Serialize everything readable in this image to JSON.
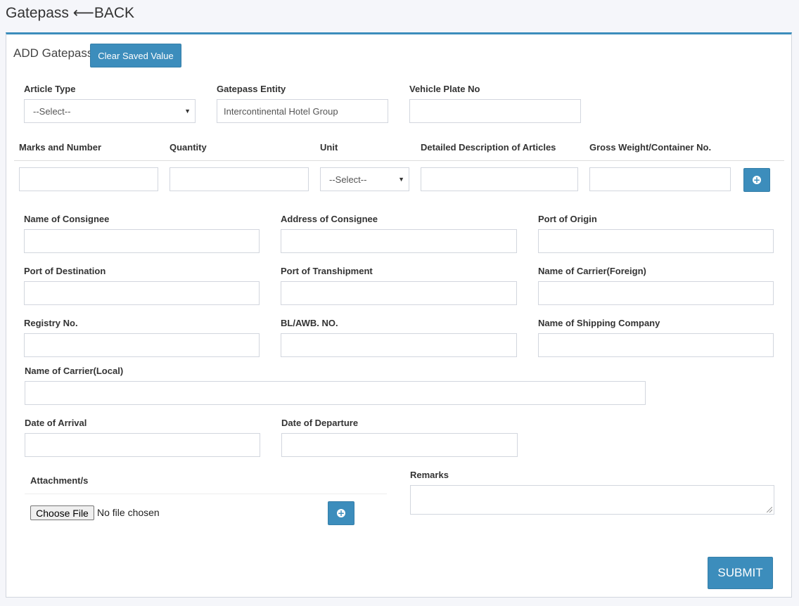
{
  "header": {
    "title": "Gatepass",
    "back_label": "⟵BACK"
  },
  "box": {
    "title": "ADD Gatepass",
    "clear_button": "Clear Saved Value"
  },
  "row1": {
    "article_type": {
      "label": "Article Type",
      "value": "--Select--"
    },
    "gatepass_entity": {
      "label": "Gatepass Entity",
      "value": "Intercontinental Hotel Group"
    },
    "vehicle_plate": {
      "label": "Vehicle Plate No",
      "value": ""
    }
  },
  "articles_table": {
    "headers": [
      "Marks and Number",
      "Quantity",
      "Unit",
      "Detailed Description of Articles",
      "Gross Weight/Container No."
    ],
    "unit_value": "--Select--"
  },
  "fields": {
    "name_of_consignee": "Name of Consignee",
    "address_of_consignee": "Address of Consignee",
    "port_of_origin": "Port of Origin",
    "port_of_destination": "Port of Destination",
    "port_of_transhipment": "Port of Transhipment",
    "name_of_carrier_foreign": "Name of Carrier(Foreign)",
    "registry_no": "Registry No.",
    "bl_awb_no": "BL/AWB. NO.",
    "name_of_shipping_company": "Name of Shipping Company",
    "name_of_carrier_local": "Name of Carrier(Local)",
    "date_of_arrival": "Date of Arrival",
    "date_of_departure": "Date of Departure"
  },
  "attachments": {
    "label": "Attachment/s",
    "choose_file": "Choose File",
    "no_file": "No file chosen"
  },
  "remarks": {
    "label": "Remarks"
  },
  "submit_label": "SUBMIT",
  "colors": {
    "primary": "#3c8dbc",
    "border": "#d2d6de",
    "background": "#f5f6fa"
  }
}
